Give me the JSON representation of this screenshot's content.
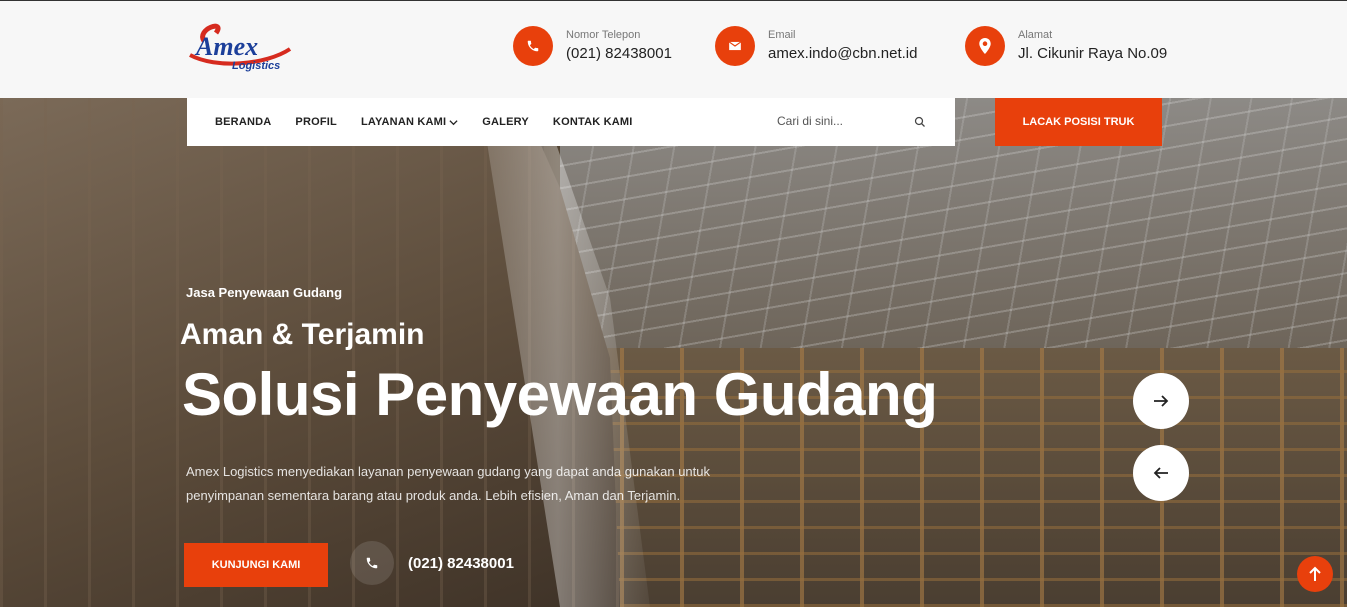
{
  "brand": {
    "logo_text_main": "Amex",
    "logo_text_sub": "Logistics",
    "colors": {
      "accent": "#e8400c",
      "logo_blue": "#1c3f9a",
      "logo_red": "#d62b1f"
    }
  },
  "header": {
    "contacts": [
      {
        "label": "Nomor Telepon",
        "value": "(021) 82438001",
        "icon": "phone-icon"
      },
      {
        "label": "Email",
        "value": "amex.indo@cbn.net.id",
        "icon": "email-icon"
      },
      {
        "label": "Alamat",
        "value": "Jl. Cikunir Raya No.09",
        "icon": "location-pin-icon"
      }
    ]
  },
  "nav": {
    "items": [
      "BERANDA",
      "PROFIL",
      "LAYANAN KAMI",
      "GALERY",
      "KONTAK KAMI"
    ],
    "search_placeholder": "Cari di sini...",
    "track_button": "LACAK POSISI TRUK"
  },
  "hero": {
    "eyebrow": "Jasa Penyewaan Gudang",
    "subtitle": "Aman & Terjamin",
    "title": "Solusi Penyewaan Gudang",
    "description_line1": "Amex Logistics menyediakan layanan penyewaan gudang yang dapat anda gunakan untuk",
    "description_line2": "penyimpanan sementara barang atau produk anda. Lebih efisien, Aman dan Terjamin.",
    "cta_label": "KUNJUNGI KAMI",
    "phone": "(021) 82438001"
  },
  "slider": {
    "next_icon": "arrow-right-icon",
    "prev_icon": "arrow-left-icon"
  },
  "scroll_top_icon": "arrow-up-icon"
}
